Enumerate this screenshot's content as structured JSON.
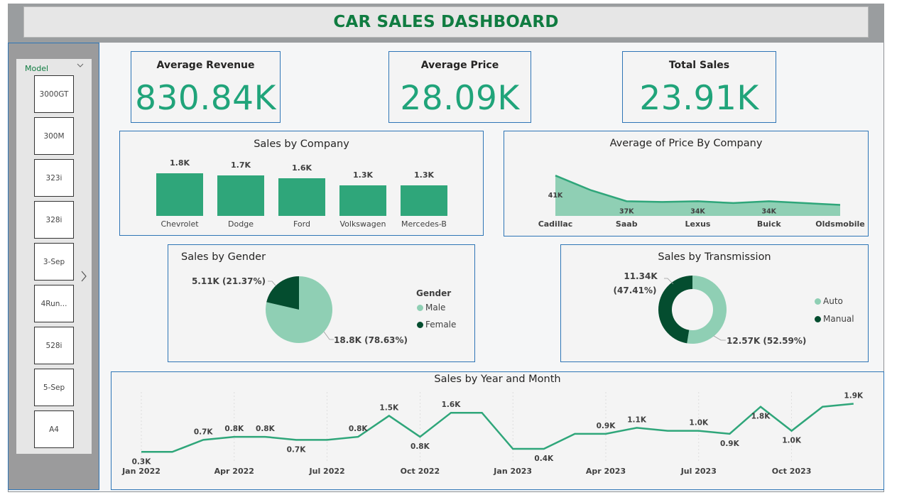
{
  "header": {
    "title": "CAR SALES DASHBOARD"
  },
  "slicer": {
    "title": "Model",
    "items": [
      "3000GT",
      "300M",
      "323i",
      "328i",
      "3-Sep",
      "4Run...",
      "528i",
      "5-Sep",
      "A4"
    ]
  },
  "kpis": [
    {
      "label": "Average Revenue",
      "value": "830.84K"
    },
    {
      "label": "Average Price",
      "value": "28.09K"
    },
    {
      "label": "Total Sales",
      "value": "23.91K"
    }
  ],
  "colors": {
    "primary": "#2fa67a",
    "light": "#8fcfb4",
    "dark": "#044d2f",
    "title": "#107c41",
    "border": "#2e75b6"
  },
  "sales_by_company": {
    "title": "Sales by Company",
    "chart_data": {
      "type": "bar",
      "categories": [
        "Chevrolet",
        "Dodge",
        "Ford",
        "Volkswagen",
        "Mercedes-B"
      ],
      "values": [
        1.8,
        1.7,
        1.6,
        1.3,
        1.3
      ],
      "labels": [
        "1.8K",
        "1.7K",
        "1.6K",
        "1.3K",
        "1.3K"
      ],
      "unit": "K"
    }
  },
  "avg_price_by_company": {
    "title": "Average of Price By Company",
    "chart_data": {
      "type": "area",
      "categories": [
        "Cadillac",
        "Saab",
        "Lexus",
        "Buick",
        "Oldsmobile"
      ],
      "x_positions": [
        0,
        1,
        2,
        3,
        4
      ],
      "points": [
        [
          0,
          41
        ],
        [
          0.25,
          39
        ],
        [
          0.5,
          37
        ],
        [
          1,
          34
        ],
        [
          1.5,
          33.8
        ],
        [
          2,
          34
        ],
        [
          2.5,
          33.5
        ],
        [
          3,
          34
        ],
        [
          4,
          33
        ]
      ],
      "labels": [
        {
          "x": 0,
          "text": "41K"
        },
        {
          "x": 1,
          "text": "37K"
        },
        {
          "x": 2,
          "text": "34K"
        },
        {
          "x": 3,
          "text": "34K"
        }
      ],
      "ylim": [
        30,
        42
      ]
    }
  },
  "sales_by_gender": {
    "title": "Sales by Gender",
    "legend_title": "Gender",
    "chart_data": {
      "type": "pie",
      "slices": [
        {
          "name": "Male",
          "value": 18.8,
          "label": "18.8K (78.63%)",
          "color": "#8fcfb4"
        },
        {
          "name": "Female",
          "value": 5.11,
          "label": "5.11K (21.37%)",
          "color": "#044d2f"
        }
      ]
    }
  },
  "sales_by_transmission": {
    "title": "Sales by Transmission",
    "chart_data": {
      "type": "pie",
      "donut": true,
      "slices": [
        {
          "name": "Auto",
          "value": 12.57,
          "label": "12.57K (52.59%)",
          "color": "#8fcfb4"
        },
        {
          "name": "Manual",
          "value": 11.34,
          "label_line1": "11.34K",
          "label_line2": "(47.41%)",
          "color": "#044d2f"
        }
      ]
    }
  },
  "sales_by_year_month": {
    "title": "Sales by Year and Month",
    "chart_data": {
      "type": "line",
      "ticks": [
        "Jan 2022",
        "Apr 2022",
        "Jul 2022",
        "Oct 2022",
        "Jan 2023",
        "Apr 2023",
        "Jul 2023",
        "Oct 2023"
      ],
      "tick_index": [
        0,
        3,
        6,
        9,
        12,
        15,
        18,
        21
      ],
      "values": [
        0.3,
        0.3,
        0.7,
        0.8,
        0.8,
        0.7,
        0.7,
        0.8,
        1.5,
        0.8,
        1.6,
        1.6,
        0.4,
        0.4,
        0.9,
        0.9,
        1.1,
        1.0,
        1.0,
        0.9,
        1.8,
        1.0,
        1.8,
        1.9
      ],
      "labels": [
        {
          "i": 0,
          "text": "0.3K",
          "pos": "below"
        },
        {
          "i": 2,
          "text": "0.7K",
          "pos": "above"
        },
        {
          "i": 3,
          "text": "0.8K",
          "pos": "above"
        },
        {
          "i": 4,
          "text": "0.8K",
          "pos": "above"
        },
        {
          "i": 5,
          "text": "0.7K",
          "pos": "below"
        },
        {
          "i": 7,
          "text": "0.8K",
          "pos": "above"
        },
        {
          "i": 8,
          "text": "1.5K",
          "pos": "above"
        },
        {
          "i": 9,
          "text": "0.8K",
          "pos": "below"
        },
        {
          "i": 10,
          "text": "1.6K",
          "pos": "above"
        },
        {
          "i": 13,
          "text": "0.4K",
          "pos": "below"
        },
        {
          "i": 15,
          "text": "0.9K",
          "pos": "above"
        },
        {
          "i": 16,
          "text": "1.1K",
          "pos": "above"
        },
        {
          "i": 18,
          "text": "1.0K",
          "pos": "above"
        },
        {
          "i": 19,
          "text": "0.9K",
          "pos": "below"
        },
        {
          "i": 20,
          "text": "1.8K",
          "pos": "below"
        },
        {
          "i": 21,
          "text": "1.0K",
          "pos": "below"
        },
        {
          "i": 23,
          "text": "1.9K",
          "pos": "above"
        }
      ],
      "ylim": [
        0,
        2.1
      ]
    }
  }
}
